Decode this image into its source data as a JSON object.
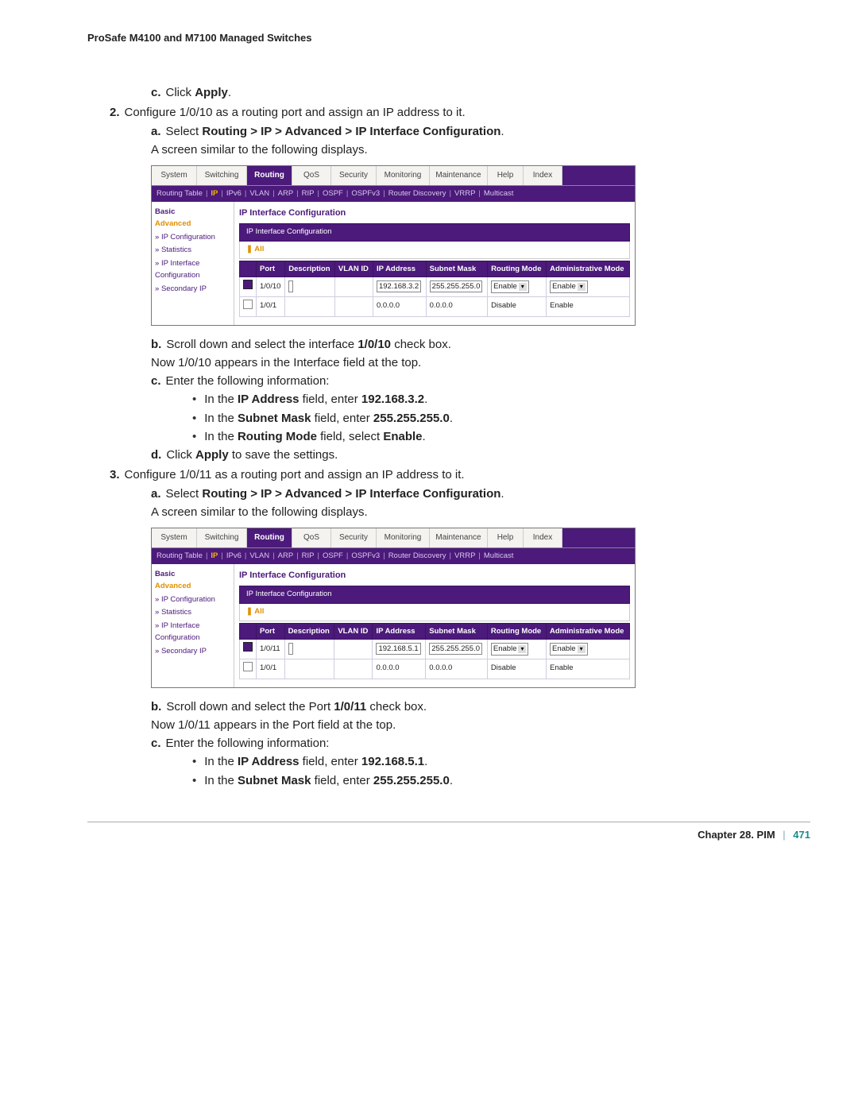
{
  "header": "ProSafe M4100 and M7100 Managed Switches",
  "steps": {
    "s1c": {
      "letter": "c.",
      "pre": "Click ",
      "bold": "Apply",
      "post": "."
    },
    "s2": {
      "num": "2.",
      "text": "Configure 1/0/10 as a routing port and assign an IP address to it."
    },
    "s2a": {
      "letter": "a.",
      "pre": "Select ",
      "bold": "Routing > IP > Advanced > IP Interface Configuration",
      "post": "."
    },
    "s2a2": "A screen similar to the following displays.",
    "s2b_full": "Scroll down and select the interface 1/0/10 check box.",
    "s2b": {
      "letter": "b.",
      "pre": "Scroll down and select the interface ",
      "bold": "1/0/10",
      "post": " check box."
    },
    "s2b2": "Now 1/0/10 appears in the Interface field at the top.",
    "s2c": {
      "letter": "c.",
      "text": "Enter the following information:"
    },
    "s2c_b1": {
      "pre_a": "In the ",
      "b1": "IP Address",
      "mid_a": " field, enter ",
      "b2": "192.168.3.2",
      "post": "."
    },
    "s2c_b2": {
      "pre_a": "In the ",
      "b1": "Subnet Mask",
      "mid_a": " field, enter ",
      "b2": "255.255.255.0",
      "post": "."
    },
    "s2c_b3": {
      "pre_a": "In the ",
      "b1": "Routing Mode",
      "mid_a": " field, select ",
      "b2": "Enable",
      "post": "."
    },
    "s2d": {
      "letter": "d.",
      "pre": "Click ",
      "bold": "Apply",
      "post": " to save the settings."
    },
    "s3": {
      "num": "3.",
      "text": "Configure 1/0/11 as a routing port and assign an IP address to it."
    },
    "s3a": {
      "letter": "a.",
      "pre": "Select ",
      "bold": "Routing > IP > Advanced > IP Interface Configuration",
      "post": "."
    },
    "s3a2": "A screen similar to the following displays.",
    "s3b": {
      "letter": "b.",
      "pre": "Scroll down and select the Port ",
      "bold": "1/0/11",
      "post": " check box."
    },
    "s3b2": "Now 1/0/11 appears in the Port field at the top.",
    "s3c": {
      "letter": "c.",
      "text": "Enter the following information:"
    },
    "s3c_b1": {
      "pre_a": "In the ",
      "b1": "IP Address",
      "mid_a": " field, enter ",
      "b2": "192.168.5.1",
      "post": "."
    },
    "s3c_b2": {
      "pre_a": "In the ",
      "b1": "Subnet Mask",
      "mid_a": " field, enter ",
      "b2": "255.255.255.0",
      "post": "."
    }
  },
  "ui": {
    "tabs": [
      "System",
      "Switching",
      "Routing",
      "QoS",
      "Security",
      "Monitoring",
      "Maintenance",
      "Help",
      "Index"
    ],
    "active_tab": "Routing",
    "subnav": [
      "Routing Table",
      "IP",
      "IPv6",
      "VLAN",
      "ARP",
      "RIP",
      "OSPF",
      "OSPFv3",
      "Router Discovery",
      "VRRP",
      "Multicast"
    ],
    "subnav_sel": "IP",
    "sidebar": {
      "basic": "Basic",
      "adv": "Advanced",
      "items": [
        "IP Configuration",
        "Statistics",
        "IP Interface Configuration",
        "Secondary IP"
      ],
      "sel_idx": 2
    },
    "panel_title": "IP Interface Configuration",
    "sub_bar": "IP Interface Configuration",
    "all": "All",
    "cols": [
      "",
      "Port",
      "Description",
      "VLAN ID",
      "IP Address",
      "Subnet Mask",
      "Routing Mode",
      "Administrative Mode"
    ]
  },
  "shot1": {
    "rows": [
      {
        "ck": true,
        "port": "1/0/10",
        "desc": "",
        "vlan": "",
        "ip": "192.168.3.2",
        "mask": "255.255.255.0",
        "rmode": "Enable",
        "amode": "Enable",
        "editable": true
      },
      {
        "ck": false,
        "port": "1/0/1",
        "desc": "",
        "vlan": "",
        "ip": "0.0.0.0",
        "mask": "0.0.0.0",
        "rmode": "Disable",
        "amode": "Enable",
        "editable": false
      }
    ]
  },
  "shot2": {
    "rows": [
      {
        "ck": true,
        "port": "1/0/11",
        "desc": "",
        "vlan": "",
        "ip": "192.168.5.1",
        "mask": "255.255.255.0",
        "rmode": "Enable",
        "amode": "Enable",
        "editable": true
      },
      {
        "ck": false,
        "port": "1/0/1",
        "desc": "",
        "vlan": "",
        "ip": "0.0.0.0",
        "mask": "0.0.0.0",
        "rmode": "Disable",
        "amode": "Enable",
        "editable": false
      }
    ]
  },
  "footer": {
    "chapter": "Chapter 28.  PIM",
    "page": "471"
  }
}
